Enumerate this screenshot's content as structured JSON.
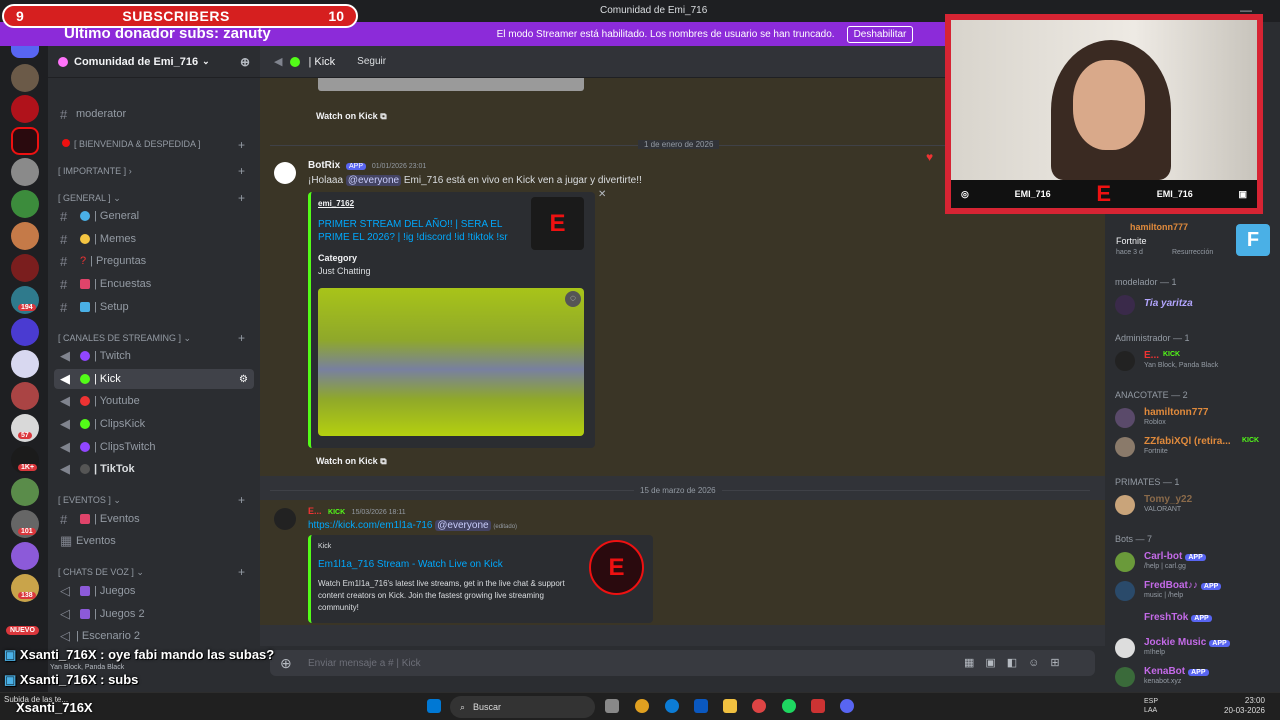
{
  "window": {
    "title": "Comunidad de Emi_716"
  },
  "overlay": {
    "sub_left": "9",
    "sub_label": "SUBSCRIBERS",
    "sub_right": "10",
    "donor": "Ultimo donador subs: zanuty"
  },
  "banner": {
    "text": "El modo Streamer está habilitado. Los nombres de usuario se han truncado.",
    "button": "Deshabilitar"
  },
  "server": {
    "name": "Comunidad de Emi_716"
  },
  "rail_badges": [
    "194",
    "57",
    "1K+",
    "101",
    "138",
    "NUEVO"
  ],
  "channels": {
    "moderator": "moderator",
    "cat_bienvenida": "[ BIENVENIDA & DESPEDIDA ]",
    "cat_importante": "[ IMPORTANTE ]",
    "cat_general": "[ GENERAL ]",
    "general": "| General",
    "memes": "| Memes",
    "preguntas": "| Preguntas",
    "encuestas": "| Encuestas",
    "setup": "| Setup",
    "cat_streaming": "[ CANALES DE STREAMING ]",
    "twitch": "| Twitch",
    "kick": "| Kick",
    "youtube": "| Youtube",
    "clipskick": "| ClipsKick",
    "clipstwitch": "| ClipsTwitch",
    "tiktok": "| TikTok",
    "cat_eventos": "[ EVENTOS ]",
    "eventos": "| Eventos",
    "eventos2": "Eventos",
    "cat_voz": "[ CHATS DE VOZ ]",
    "juegos": "| Juegos",
    "juegos2": "| Juegos 2",
    "escenario": "| Escenario 2",
    "voice_user": "Yan Block, Panda Black"
  },
  "header": {
    "channel": "| Kick",
    "follow": "Seguir"
  },
  "messages": {
    "watch1": "Watch on Kick",
    "date1": "1 de enero de 2026",
    "author1": "BotRix",
    "app": "APP",
    "time1": "01/01/2026 23:01",
    "text1_pre": "¡Holaaa",
    "everyone": "@everyone",
    "text1_post": "Emi_716 está en vivo en Kick ven a jugar y divertirte!!",
    "embed_author": "emi_7162",
    "embed_title": "PRIMER STREAM DEL AÑO!! | SERA EL PRIME EL 2026? | !ig !discord !id !tiktok !sr",
    "field_name": "Category",
    "field_value": "Just Chatting",
    "watch2": "Watch on Kick",
    "date2": "15 de marzo de 2026",
    "author2": "E...",
    "kick_tag": "KICK",
    "time2": "15/03/2026 18:11",
    "url": "https://kick.com/em1l1a-716",
    "edited": "(editado)",
    "embed2_provider": "Kick",
    "embed2_title": "Em1l1a_716 Stream - Watch Live on Kick",
    "embed2_desc": "Watch Em1l1a_716's latest live streams, get in the live chat & support content creators on Kick. Join the fastest growing live streaming community!"
  },
  "input": {
    "placeholder": "Enviar mensaje a # | Kick"
  },
  "camera": {
    "handle_left": "EMI_716",
    "handle_right": "EMI_716"
  },
  "members": {
    "top_name": "hamiltonn777",
    "top_game": "Fortnite",
    "top_time": "hace 3 d",
    "top_action": "Resurrección",
    "cat_modelador": "modelador — 1",
    "modelador": "Tia yaritza",
    "cat_admin": "Administrador — 1",
    "admin": "E...",
    "admin_status": "Yan Block, Panda Black",
    "cat_anacotate": "ANACOTATE — 2",
    "ana1": "hamiltonn777",
    "ana1_status": "Roblox",
    "ana2": "ZZfabiXQl (retira...",
    "ana2_status": "Fortnite",
    "cat_primates": "PRIMATES — 1",
    "pri1": "Tomy_y22",
    "pri1_status": "VALORANT",
    "cat_bots": "Bots — 7",
    "bot1": "Carl-bot",
    "bot1_status": "/help | carl.gg",
    "bot2": "FredBoat♪♪",
    "bot2_status": "music | /help",
    "bot3": "FreshTok",
    "bot4": "Jockie Music",
    "bot4_status": "m!help",
    "bot5": "KenaBot",
    "bot5_status": "kenabot.xyz"
  },
  "chat_overlay": {
    "line1": "Xsanti_716X : oye fabi mando las subas?",
    "line2": "Xsanti_716X : subs",
    "line3": "Xsanti_716X"
  },
  "taskbar": {
    "search": "Buscar",
    "lang1": "ESP",
    "lang2": "LAA",
    "time": "23:00",
    "date": "20-03-2026",
    "recent": "Subida de las te..."
  },
  "colors": {
    "kick_green": "#53fc18",
    "accent": "#5865f2",
    "streamer_purple": "#8c2bd9",
    "sub_red": "#d61f1f"
  }
}
